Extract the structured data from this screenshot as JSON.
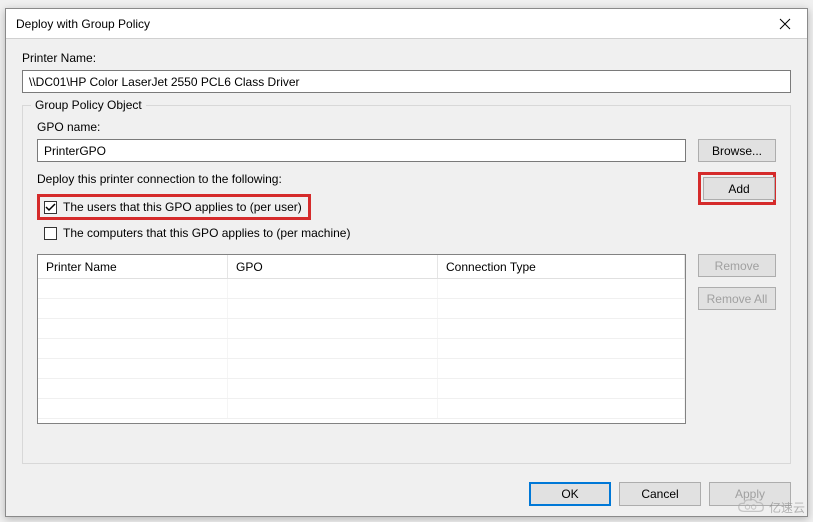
{
  "window": {
    "title": "Deploy with Group Policy"
  },
  "labels": {
    "printer_name": "Printer Name:",
    "gpo_object": "Group Policy Object",
    "gpo_name": "GPO name:",
    "deploy_to": "Deploy this printer connection to the following:"
  },
  "fields": {
    "printer_path": "\\\\DC01\\HP Color LaserJet 2550 PCL6 Class Driver",
    "gpo_name_value": "PrinterGPO"
  },
  "checkboxes": {
    "per_user": {
      "label": "The users that this GPO applies to (per user)",
      "checked": true
    },
    "per_machine": {
      "label": "The computers that this GPO applies to (per machine)",
      "checked": false
    }
  },
  "buttons": {
    "browse": "Browse...",
    "add": "Add",
    "remove": "Remove",
    "remove_all": "Remove All",
    "ok": "OK",
    "cancel": "Cancel",
    "apply": "Apply"
  },
  "table": {
    "headers": {
      "printer_name": "Printer Name",
      "gpo": "GPO",
      "connection_type": "Connection Type"
    },
    "rows": []
  },
  "watermark": "亿速云"
}
